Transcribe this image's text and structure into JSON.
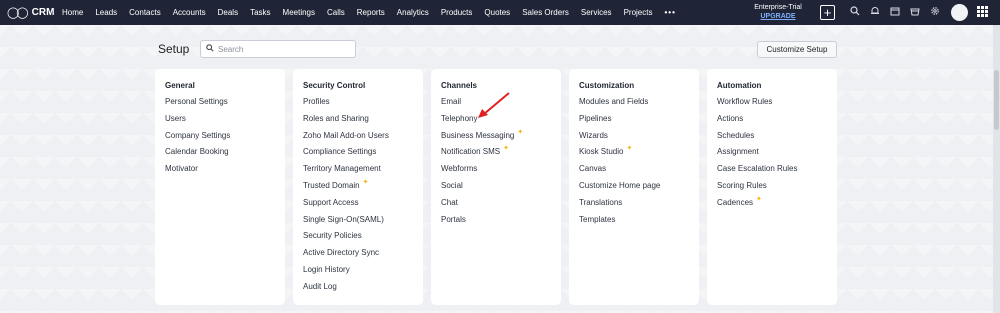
{
  "app": {
    "logo_text": "CRM"
  },
  "nav": [
    "Home",
    "Leads",
    "Contacts",
    "Accounts",
    "Deals",
    "Tasks",
    "Meetings",
    "Calls",
    "Reports",
    "Analytics",
    "Products",
    "Quotes",
    "Sales Orders",
    "Services",
    "Projects"
  ],
  "nav_more": "•••",
  "trial": {
    "label": "Enterprise-Trial",
    "upgrade": "UPGRADE"
  },
  "header": {
    "title": "Setup",
    "search_placeholder": "Search",
    "customize_label": "Customize Setup"
  },
  "cards": [
    {
      "title": "General",
      "items": [
        {
          "label": "Personal Settings"
        },
        {
          "label": "Users"
        },
        {
          "label": "Company Settings"
        },
        {
          "label": "Calendar Booking"
        },
        {
          "label": "Motivator"
        }
      ]
    },
    {
      "title": "Security Control",
      "items": [
        {
          "label": "Profiles"
        },
        {
          "label": "Roles and Sharing"
        },
        {
          "label": "Zoho Mail Add-on Users"
        },
        {
          "label": "Compliance Settings"
        },
        {
          "label": "Territory Management"
        },
        {
          "label": "Trusted Domain",
          "new": true
        },
        {
          "label": "Support Access"
        },
        {
          "label": "Single Sign-On(SAML)"
        },
        {
          "label": "Security Policies"
        },
        {
          "label": "Active Directory Sync"
        },
        {
          "label": "Login History"
        },
        {
          "label": "Audit Log"
        }
      ]
    },
    {
      "title": "Channels",
      "items": [
        {
          "label": "Email"
        },
        {
          "label": "Telephony"
        },
        {
          "label": "Business Messaging",
          "new": true
        },
        {
          "label": "Notification SMS",
          "new": true
        },
        {
          "label": "Webforms"
        },
        {
          "label": "Social"
        },
        {
          "label": "Chat"
        },
        {
          "label": "Portals"
        }
      ]
    },
    {
      "title": "Customization",
      "items": [
        {
          "label": "Modules and Fields"
        },
        {
          "label": "Pipelines"
        },
        {
          "label": "Wizards"
        },
        {
          "label": "Kiosk Studio",
          "new": true
        },
        {
          "label": "Canvas"
        },
        {
          "label": "Customize Home page"
        },
        {
          "label": "Translations"
        },
        {
          "label": "Templates"
        }
      ]
    },
    {
      "title": "Automation",
      "items": [
        {
          "label": "Workflow Rules"
        },
        {
          "label": "Actions"
        },
        {
          "label": "Schedules"
        },
        {
          "label": "Assignment"
        },
        {
          "label": "Case Escalation Rules"
        },
        {
          "label": "Scoring Rules"
        },
        {
          "label": "Cadences",
          "new": true
        }
      ]
    }
  ],
  "colors": {
    "topbar": "#1f2536",
    "accent": "#7fb0ff",
    "new_badge": "#f4b400",
    "annotation_arrow": "#e02020"
  }
}
